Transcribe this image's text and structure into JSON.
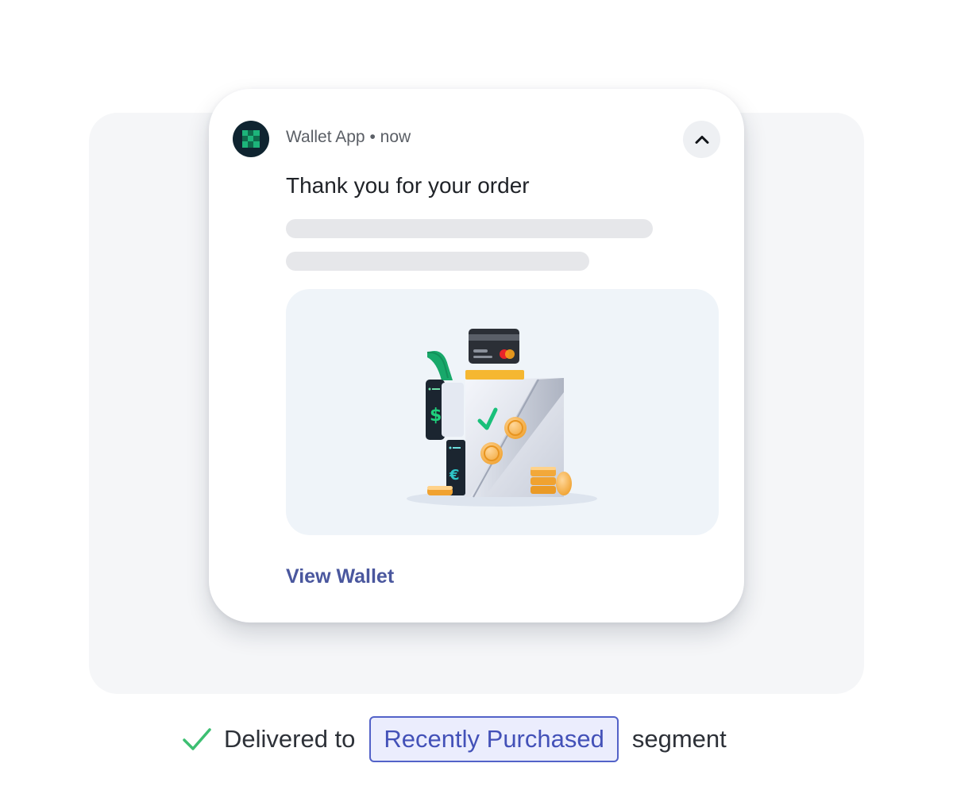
{
  "notification": {
    "app_name": "Wallet App",
    "separator": "•",
    "timestamp": "now",
    "title": "Thank you for your order",
    "action_label": "View Wallet",
    "app_icon": "checkered-square-icon",
    "collapse_icon": "chevron-up-icon",
    "illustration": "wallet-payment-illustration"
  },
  "status": {
    "check_icon": "check-icon",
    "prefix": "Delivered to",
    "segment": "Recently Purchased",
    "suffix": "segment"
  },
  "colors": {
    "action": "#4a579e",
    "segment_border": "#5362c8",
    "segment_bg": "#ebedfd",
    "check": "#3dbf72"
  }
}
